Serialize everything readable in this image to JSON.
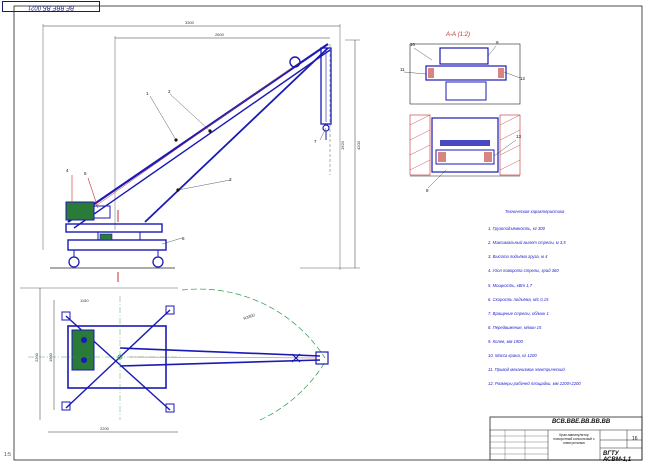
{
  "stamp_top": "ВЕ.ВВЕ.ВБ.0021",
  "section_label": "А-А (1:2)",
  "title_block": {
    "code": "ВСВ.ВВЕ.ВВ.ВВ.ВВ",
    "title": "Кран-манипулятор поворотный консольный с электроталью",
    "sheets": "16",
    "group": "ВГТУ АСВМ-1,1"
  },
  "notes": [
    "Техническая характеристика",
    "1. Грузоподъёмность, кг  300",
    "2. Максимальный вылет стрелы, м  3,5",
    "3. Высота подъёма груза, м  4",
    "4. Угол поворота стрелы, град  360",
    "5. Мощность, кВт  1,7",
    "6. Скорость подъёма, м/с  0,15",
    "7. Вращение стрелы, об/мин  1",
    "8. Передвижение, м/мин  15",
    "9. Колея, мм  1900",
    "10. Масса крана, кг  1200",
    "11. Привод механизмов электрический",
    "12. Размеры рабочей площадки, мм  2200×2200"
  ],
  "dims": {
    "top_width": "3300",
    "boom_reach": "2600",
    "height": "4200",
    "side_h": "1920",
    "plan_w": "2200",
    "plan_h": "2200",
    "plan_h2": "1900",
    "radius": "R3300",
    "diag": "1150"
  },
  "callouts": [
    "1",
    "2",
    "3",
    "4",
    "5",
    "6",
    "7",
    "8",
    "9",
    "10",
    "11",
    "12",
    "13"
  ],
  "corner_mark": "1:5",
  "colors": {
    "structure": "#1a1ab4",
    "frame": "#111111",
    "motor": "#2a7a3a",
    "dim": "#333333"
  }
}
